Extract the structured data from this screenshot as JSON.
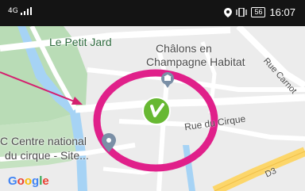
{
  "status_bar": {
    "signal_text": "4G",
    "battery": "56",
    "time": "16:07"
  },
  "map": {
    "labels": {
      "petit_jard": "Le Petit Jard",
      "chalons_line1": "Châlons en",
      "chalons_line2": "Champagne Habitat",
      "rue_carnot": "Rue Carnot",
      "rue_du_cirque": "Rue du Cirque",
      "centre_line1": "C Centre national",
      "centre_line2": "du cirque - Site...",
      "road_d3": "D3"
    },
    "google": [
      "G",
      "o",
      "o",
      "g",
      "l",
      "e"
    ]
  },
  "colors": {
    "highlight_circle": "#e0208a",
    "annotation_arrow": "#d4206f",
    "marker_green": "#67b832",
    "water": "#a6d3f5",
    "park": "#b9dcb6",
    "road_yellow": "#fcd66a",
    "google_blue": "#4285f4",
    "google_red": "#ea4335",
    "google_yellow": "#fbbc05",
    "google_green": "#34a853"
  },
  "icons": {
    "bank": "bank-icon",
    "marker": "place-marker-icon",
    "vibration": "vibration-icon",
    "location": "location-icon"
  }
}
